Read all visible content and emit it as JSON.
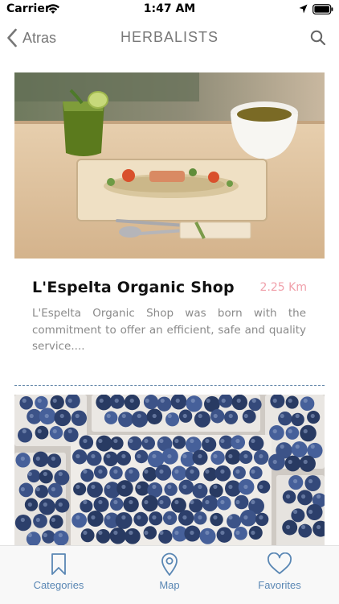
{
  "status_bar": {
    "carrier": "Carrier",
    "time": "1:47 AM",
    "icons": [
      "wifi-icon",
      "location-arrow-icon",
      "battery-icon"
    ]
  },
  "nav": {
    "back_label": "Atras",
    "title": "HERBALISTS",
    "icons": [
      "chevron-left-icon",
      "search-icon"
    ]
  },
  "shops": [
    {
      "name": "L'Espelta Organic Shop",
      "distance": "2.25 Km",
      "description": "L'Espelta Organic Shop was born with the commitment to offer an efficient, safe and quality service....",
      "image": "food-plate-photo"
    },
    {
      "image": "blueberries-photo"
    }
  ],
  "tabs": [
    {
      "label": "Categories",
      "icon": "bookmark-icon"
    },
    {
      "label": "Map",
      "icon": "map-pin-icon"
    },
    {
      "label": "Favorites",
      "icon": "heart-icon"
    }
  ],
  "colors": {
    "accent": "#5a87b4",
    "distance": "#f0a0aa",
    "nav_text": "#777777",
    "description_text": "#8a8a8a",
    "divider": "#5a7fa3"
  }
}
